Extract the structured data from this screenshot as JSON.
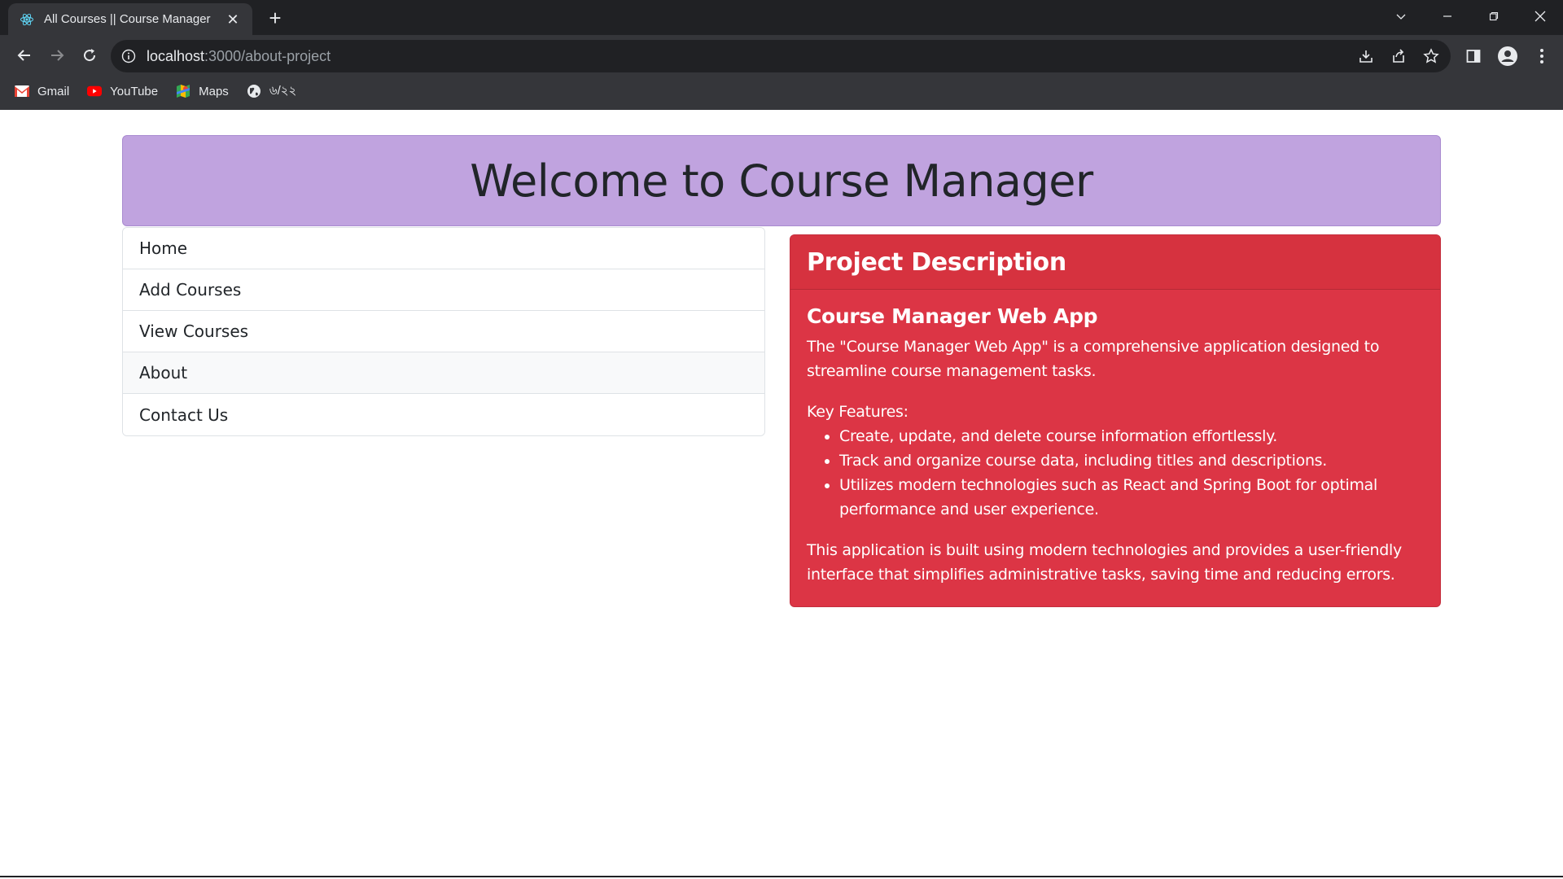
{
  "browser": {
    "tab_title": "All Courses || Course Manager",
    "url_host": "localhost",
    "url_path": ":3000/about-project",
    "bookmarks": [
      {
        "label": "Gmail",
        "icon": "gmail-icon"
      },
      {
        "label": "YouTube",
        "icon": "youtube-icon"
      },
      {
        "label": "Maps",
        "icon": "maps-icon"
      },
      {
        "label": "৬/২২",
        "icon": "globe-icon"
      }
    ]
  },
  "header": {
    "title": "Welcome to Course Manager"
  },
  "menu": {
    "items": [
      {
        "label": "Home"
      },
      {
        "label": "Add Courses"
      },
      {
        "label": "View Courses"
      },
      {
        "label": "About",
        "active": true
      },
      {
        "label": "Contact Us"
      }
    ]
  },
  "card": {
    "header": "Project Description",
    "title": "Course Manager Web App",
    "intro": "The \"Course Manager Web App\" is a comprehensive application designed to streamline course management tasks.",
    "features_label": "Key Features:",
    "features": [
      "Create, update, and delete course information effortlessly.",
      "Track and organize course data, including titles and descriptions.",
      "Utilizes modern technologies such as React and Spring Boot for optimal performance and user experience."
    ],
    "closing": "This application is built using modern technologies and provides a user-friendly interface that simplifies administrative tasks, saving time and reducing errors.",
    "color": "#dc3545"
  },
  "colors": {
    "hero_bg": "#c0a3df",
    "card_bg": "#dc3545"
  }
}
